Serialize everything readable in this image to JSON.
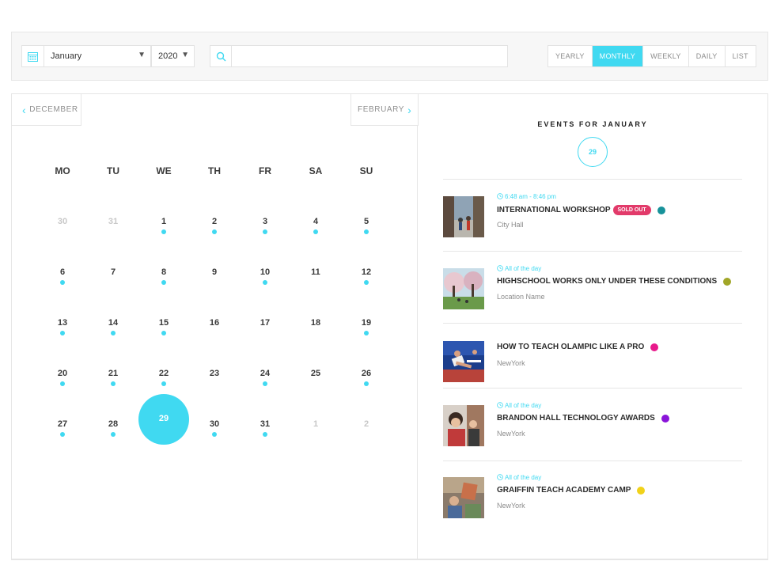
{
  "filters": {
    "calendar_icon": "calendar-icon",
    "month_value": "January",
    "year_value": "2020",
    "search_icon": "search-icon",
    "search_placeholder": "",
    "views": [
      "YEARLY",
      "MONTHLY",
      "WEEKLY",
      "DAILY",
      "LIST"
    ],
    "active_view": "MONTHLY"
  },
  "calendar": {
    "prev_label": "DECEMBER",
    "next_label": "FEBRUARY",
    "weekdays": [
      "MO",
      "TU",
      "WE",
      "TH",
      "FR",
      "SA",
      "SU"
    ],
    "weeks": [
      [
        {
          "d": "30",
          "m": true,
          "e": false
        },
        {
          "d": "31",
          "m": true,
          "e": false
        },
        {
          "d": "1",
          "m": false,
          "e": true
        },
        {
          "d": "2",
          "m": false,
          "e": true
        },
        {
          "d": "3",
          "m": false,
          "e": true
        },
        {
          "d": "4",
          "m": false,
          "e": true
        },
        {
          "d": "5",
          "m": false,
          "e": true
        }
      ],
      [
        {
          "d": "6",
          "m": false,
          "e": true
        },
        {
          "d": "7",
          "m": false,
          "e": false
        },
        {
          "d": "8",
          "m": false,
          "e": true
        },
        {
          "d": "9",
          "m": false,
          "e": false
        },
        {
          "d": "10",
          "m": false,
          "e": true
        },
        {
          "d": "11",
          "m": false,
          "e": false
        },
        {
          "d": "12",
          "m": false,
          "e": true
        }
      ],
      [
        {
          "d": "13",
          "m": false,
          "e": true
        },
        {
          "d": "14",
          "m": false,
          "e": true
        },
        {
          "d": "15",
          "m": false,
          "e": true
        },
        {
          "d": "16",
          "m": false,
          "e": false
        },
        {
          "d": "17",
          "m": false,
          "e": false
        },
        {
          "d": "18",
          "m": false,
          "e": false
        },
        {
          "d": "19",
          "m": false,
          "e": true
        }
      ],
      [
        {
          "d": "20",
          "m": false,
          "e": true
        },
        {
          "d": "21",
          "m": false,
          "e": true
        },
        {
          "d": "22",
          "m": false,
          "e": true
        },
        {
          "d": "23",
          "m": false,
          "e": false
        },
        {
          "d": "24",
          "m": false,
          "e": true
        },
        {
          "d": "25",
          "m": false,
          "e": false
        },
        {
          "d": "26",
          "m": false,
          "e": true
        }
      ],
      [
        {
          "d": "27",
          "m": false,
          "e": true
        },
        {
          "d": "28",
          "m": false,
          "e": true
        },
        {
          "d": "29",
          "m": false,
          "e": false,
          "s": true
        },
        {
          "d": "30",
          "m": false,
          "e": true
        },
        {
          "d": "31",
          "m": false,
          "e": true
        },
        {
          "d": "1",
          "m": true,
          "e": false
        },
        {
          "d": "2",
          "m": true,
          "e": false
        }
      ]
    ]
  },
  "events_panel": {
    "title": "EVENTS FOR JANUARY",
    "selected_day": "29",
    "events": [
      {
        "time": "6:48 am - 8:46 pm",
        "name": "INTERNATIONAL WORKSHOP",
        "badge": "SOLD OUT",
        "location": "City Hall",
        "color": "#17929a",
        "thumb": "thumb-street"
      },
      {
        "time": "All of the day",
        "name": "HIGHSCHOOL WORKS ONLY UNDER THESE CONDITIONS",
        "badge": "",
        "location": "Location Name",
        "color": "#a1a627",
        "thumb": "thumb-park"
      },
      {
        "time": "",
        "name": "HOW TO TEACH OLAMPIC LIKE A PRO",
        "badge": "",
        "location": "NewYork",
        "color": "#e8198b",
        "thumb": "thumb-athletes"
      },
      {
        "time": "All of the day",
        "name": "BRANDON HALL TECHNOLOGY AWARDS",
        "badge": "",
        "location": "NewYork",
        "color": "#8a14d9",
        "thumb": "thumb-awards"
      },
      {
        "time": "All of the day",
        "name": "GRAIFFIN TEACH ACADEMY CAMP",
        "badge": "",
        "location": "NewYork",
        "color": "#f1d21a",
        "thumb": "thumb-camp"
      }
    ]
  },
  "colors": {
    "accent": "#40d9f1",
    "badge": "#e23a6a"
  }
}
